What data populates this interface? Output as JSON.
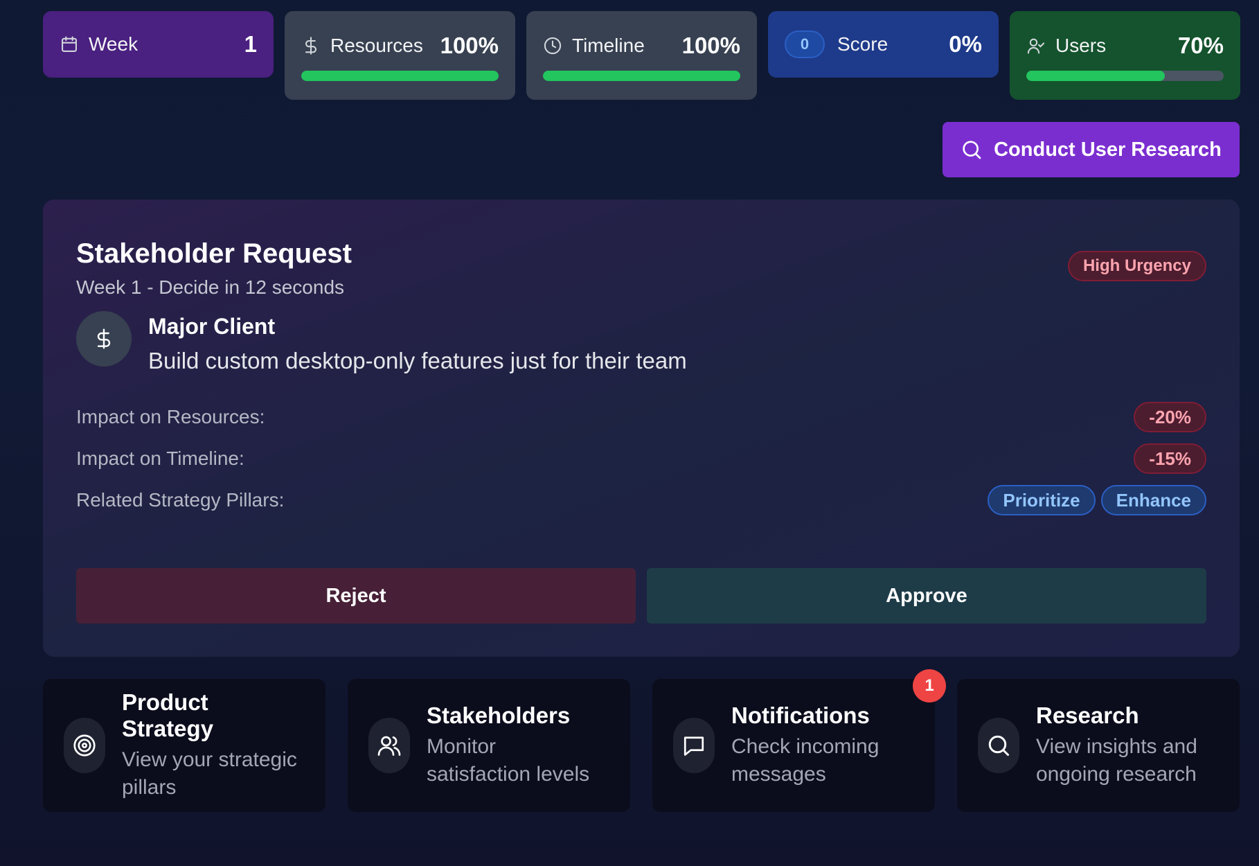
{
  "stats": {
    "week": {
      "label": "Week",
      "value": "1",
      "icon": "calendar-icon",
      "bg": "#4a2080"
    },
    "resources": {
      "label": "Resources",
      "value": "100%",
      "icon": "dollar-icon",
      "progress": 100,
      "bg": "#374151"
    },
    "timeline": {
      "label": "Timeline",
      "value": "100%",
      "icon": "clock-icon",
      "progress": 100,
      "bg": "#374151"
    },
    "score": {
      "badge": "0",
      "label": "Score",
      "value": "0%",
      "bg": "#1e3a8a"
    },
    "users": {
      "label": "Users",
      "value": "70%",
      "icon": "user-check-icon",
      "progress": 70,
      "bg": "#14532d"
    }
  },
  "research_button": {
    "label": "Conduct User Research",
    "icon": "search-icon"
  },
  "request": {
    "title": "Stakeholder Request",
    "subtitle": "Week 1 - Decide in 12 seconds",
    "urgency": "High Urgency",
    "client_name": "Major Client",
    "client_icon": "dollar-icon",
    "description": "Build custom desktop-only features just for their team",
    "impacts": [
      {
        "label": "Impact on Resources:",
        "value": "-20%"
      },
      {
        "label": "Impact on Timeline:",
        "value": "-15%"
      }
    ],
    "pillars_label": "Related Strategy Pillars:",
    "pillars": [
      "Prioritize",
      "Enhance"
    ],
    "reject_label": "Reject",
    "approve_label": "Approve"
  },
  "nav_tiles": [
    {
      "title": "Product Strategy",
      "desc_line1": "View your strategic",
      "desc_line2": "pillars",
      "icon": "target-icon"
    },
    {
      "title": "Stakeholders",
      "desc_line1": "Monitor",
      "desc_line2": "satisfaction levels",
      "icon": "users-icon"
    },
    {
      "title": "Notifications",
      "desc_line1": "Check incoming",
      "desc_line2": "messages",
      "icon": "message-icon",
      "badge": "1"
    },
    {
      "title": "Research",
      "desc_line1": "View insights and",
      "desc_line2": "ongoing research",
      "icon": "search-icon"
    }
  ],
  "colors": {
    "progress_fill": "#22c55e",
    "accent_purple": "#7b2ed0",
    "danger": "#ef4444",
    "pillar_blue": "#93c5fd"
  }
}
